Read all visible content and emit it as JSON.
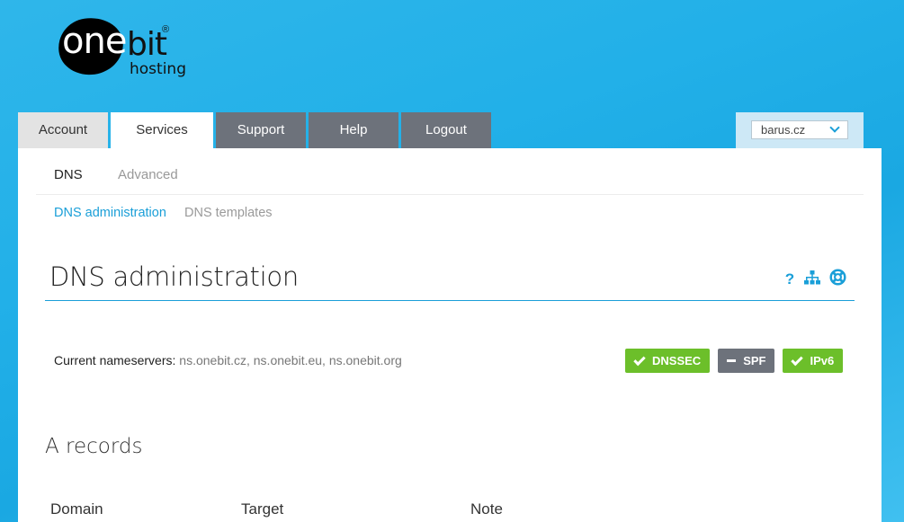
{
  "logo": {
    "word1": "one",
    "word2": "bit",
    "reg": "®",
    "tagline": "hosting"
  },
  "tabs": [
    {
      "label": "Account",
      "active": false
    },
    {
      "label": "Services",
      "active": true
    },
    {
      "label": "Support",
      "active": false
    },
    {
      "label": "Help",
      "active": false
    },
    {
      "label": "Logout",
      "active": false
    }
  ],
  "domain_select": {
    "value": "barus.cz"
  },
  "subnav": {
    "items": [
      {
        "label": "DNS",
        "active": true
      },
      {
        "label": "Advanced",
        "active": false
      }
    ]
  },
  "subsubnav": {
    "items": [
      {
        "label": "DNS administration",
        "active": true
      },
      {
        "label": "DNS templates",
        "active": false
      }
    ]
  },
  "page": {
    "title": "DNS administration",
    "help_glyph": "?"
  },
  "nameservers": {
    "label": "Current nameservers:",
    "value": "ns.onebit.cz, ns.onebit.eu, ns.onebit.org"
  },
  "badges": [
    {
      "label": "DNSSEC",
      "state": "enabled",
      "icon": "check-icon"
    },
    {
      "label": "SPF",
      "state": "disabled",
      "icon": "dash-icon"
    },
    {
      "label": "IPv6",
      "state": "enabled",
      "icon": "check-icon"
    }
  ],
  "records": {
    "title": "A records",
    "columns": [
      "Domain",
      "Target",
      "Note"
    ]
  },
  "colors": {
    "accent": "#1a9fd8",
    "green": "#6cbf2a",
    "dark_tab": "#6d727b"
  }
}
